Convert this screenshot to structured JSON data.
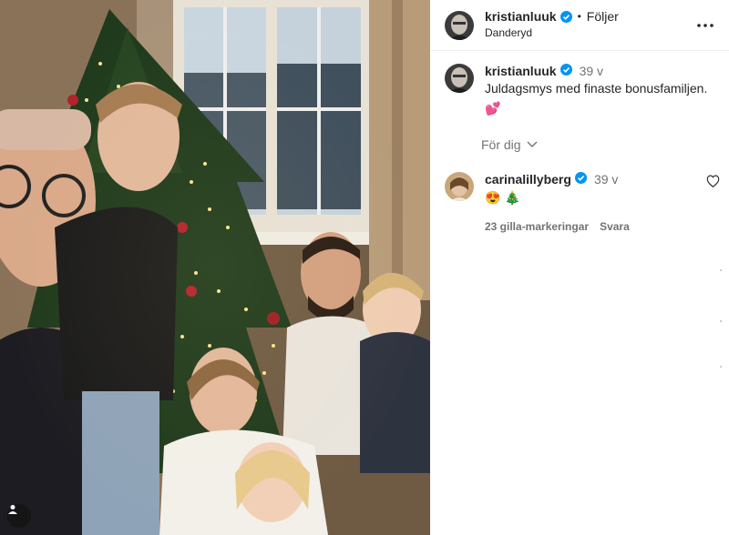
{
  "post_author": {
    "username": "kristianluuk",
    "follow_label": "Följer",
    "location": "Danderyd"
  },
  "caption": {
    "username": "kristianluuk",
    "time": "39 v",
    "text": "Juldagsmys med finaste bonusfamiljen.",
    "emoji": "💕"
  },
  "see_translation_label": "För dig",
  "comment": {
    "username": "carinalillyberg",
    "time": "39 v",
    "emoji_1": "😍",
    "emoji_2": "🎄",
    "likes_label": "23 gilla-markeringar",
    "reply_label": "Svara"
  },
  "icons": {
    "verified": "verified-badge-icon",
    "more": "more-options-icon",
    "chevron": "chevron-down-icon",
    "heart": "heart-icon",
    "user_tag": "user-tag-icon"
  },
  "colors": {
    "verified": "#0095f6",
    "secondary_text": "#737373",
    "primary_text": "#262626"
  }
}
